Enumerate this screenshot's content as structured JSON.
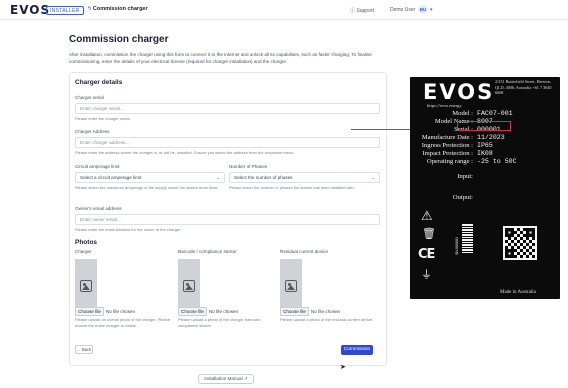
{
  "topbar": {
    "logo": "EVOS",
    "role_badge": "INSTALLER",
    "breadcrumb": "Commission charger",
    "support": "Support",
    "user_name": "Demo User",
    "user_initials": "BU"
  },
  "page": {
    "title": "Commission charger",
    "intro": "After installation, commission the charger using this form to connect it to the internet and unlock all its capabilities, such as faster charging. To finalise commissioning, enter the details of your electrical license (required for charger installation) and the charger."
  },
  "form": {
    "section_title": "Charger details",
    "serial": {
      "label": "Charger serial",
      "placeholder": "Enter charger serial...",
      "hint": "Please enter the charger serial."
    },
    "address": {
      "label": "Charger Address",
      "placeholder": "Enter charger address...",
      "hint": "Please enter the address where the charger is, or will be, installed. Ensure you select the address from the dropdown menu."
    },
    "amperage": {
      "label": "Circuit amperage limit",
      "value": "Select a circuit amperage limit",
      "hint": "Please select the maximum amperage of the supply circuit the station most drew."
    },
    "phases": {
      "label": "Number of Phases",
      "value": "Select the number of phases",
      "hint": "Please select the number of phases the station has been installed with."
    },
    "owner_email": {
      "label": "Owner's email address",
      "placeholder": "Enter owner email...",
      "hint": "Please enter the email address for the owner of the charger."
    },
    "photos": {
      "title": "Photos",
      "items": [
        {
          "label": "Charger",
          "file_button": "Choose file",
          "file_status": "No file chosen",
          "hint": "Please upload an overall photo of the charger. Please ensure the entire charger is visible."
        },
        {
          "label": "Barcode / compliance sticker",
          "file_button": "Choose file",
          "file_status": "No file chosen",
          "hint": "Please upload a photo of the charger barcode / compliance sticker."
        },
        {
          "label": "Residual current device",
          "file_button": "Choose file",
          "file_status": "No file chosen",
          "hint": "Please upload a photo of the residual current device."
        }
      ]
    },
    "back_button": "← Back",
    "commission_button": "Commission"
  },
  "installation_manual": "Installation Manual ↗",
  "plate": {
    "logo": "EVOS",
    "url": "https://evos.energy",
    "address": "2/231 Butterfield Street, Herston, QLD, 4006, Australia +61 7 3040 6668",
    "specs": [
      {
        "key": "Model :",
        "value": "FAC07-001"
      },
      {
        "key": "Model Name :",
        "value": "S007"
      },
      {
        "key": "Serial :",
        "value": "000001"
      },
      {
        "key": "Manufacture Date :",
        "value": "11/2023"
      },
      {
        "key": "Ingress Protection :",
        "value": "IP65"
      },
      {
        "key": "Impact Protection :",
        "value": "IK08"
      },
      {
        "key": "Operating range :",
        "value": "-25 to 50C"
      },
      {
        "key": "Input:",
        "value": ""
      },
      {
        "key": "Output:",
        "value": ""
      }
    ],
    "barcode_text": "SN:000001",
    "made_in": "Made in Australia"
  },
  "colors": {
    "accent": "#2f4ad0",
    "highlight": "#d23333",
    "plate_bg": "#0b0b0b"
  }
}
